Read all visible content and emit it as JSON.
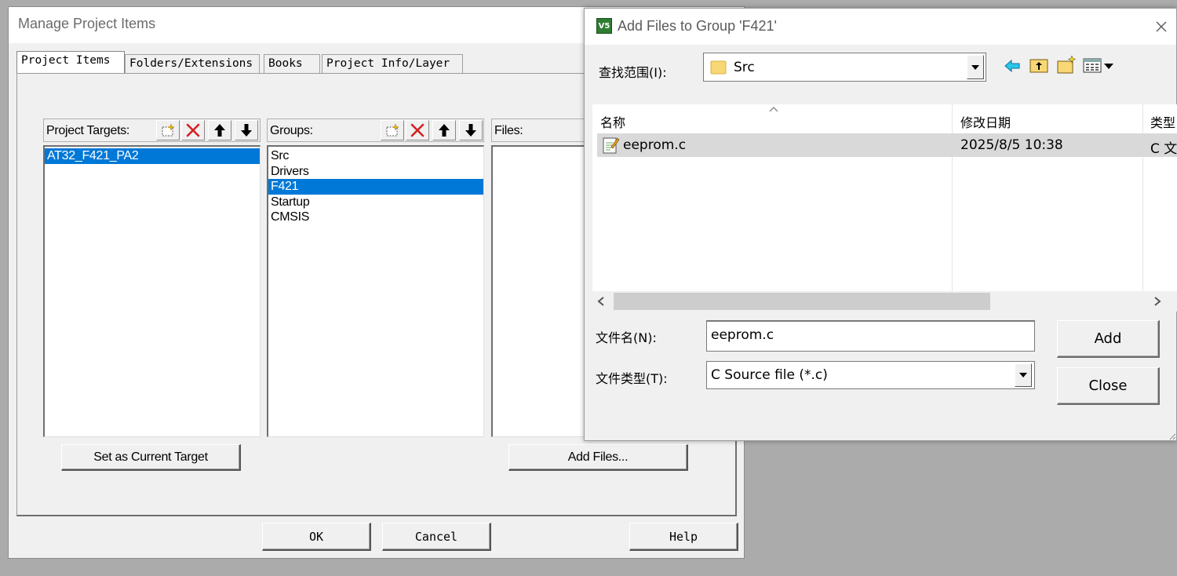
{
  "manage_window": {
    "title": "Manage Project Items",
    "tabs": [
      "Project Items",
      "Folders/Extensions",
      "Books",
      "Project Info/Layer"
    ],
    "targets": {
      "label": "Project Targets:",
      "items": [
        "AT32_F421_PA2"
      ],
      "selected_index": 0,
      "button_label": "Set as Current Target"
    },
    "groups": {
      "label": "Groups:",
      "items": [
        "Src",
        "Drivers",
        "F421",
        "Startup",
        "CMSIS"
      ],
      "selected_index": 2
    },
    "files": {
      "label": "Files:",
      "items": [],
      "button_label": "Add Files..."
    },
    "toolbar_icons": [
      "new-item-icon",
      "delete-icon",
      "move-up-icon",
      "move-down-icon"
    ],
    "buttons": {
      "ok": "OK",
      "cancel": "Cancel",
      "help": "Help"
    }
  },
  "add_files_dialog": {
    "title": "Add Files to Group 'F421'",
    "app_icon_text": "V5",
    "look_in_label": "查找范围(I):",
    "look_in_value": "Src",
    "nav_icons": [
      "back-arrow-icon",
      "up-folder-icon",
      "new-folder-icon",
      "view-menu-icon"
    ],
    "columns": [
      "名称",
      "修改日期",
      "类型"
    ],
    "files": [
      {
        "name": "eeprom.c",
        "modified": "2025/8/5 10:38",
        "type": "C 文件"
      }
    ],
    "filename_label": "文件名(N):",
    "filename_value": "eeprom.c",
    "filetype_label": "文件类型(T):",
    "filetype_value": "C Source file (*.c)",
    "add_button": "Add",
    "close_button": "Close"
  },
  "colors": {
    "selection": "#0078d7",
    "dialog_bg": "#f0f0f0",
    "desktop": "#ababab",
    "delete_icon": "#d42020"
  }
}
